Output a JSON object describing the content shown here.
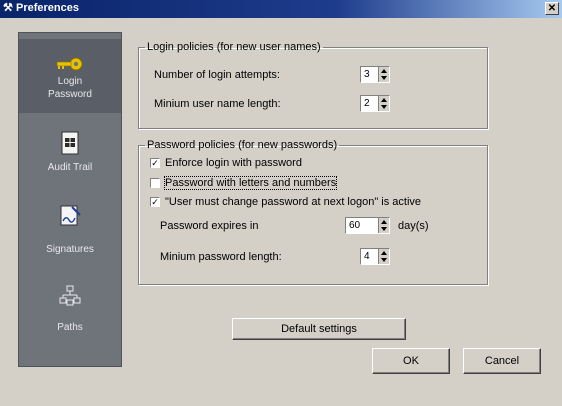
{
  "window": {
    "title": "Preferences",
    "close_symbol": "✕"
  },
  "sidebar": {
    "items": [
      {
        "label_line1": "Login",
        "label_line2": "Password",
        "icon": "key-icon"
      },
      {
        "label": "Audit Trail",
        "icon": "document-icon"
      },
      {
        "label": "Signatures",
        "icon": "signature-icon"
      },
      {
        "label": "Paths",
        "icon": "network-icon"
      }
    ]
  },
  "login_policies": {
    "legend": "Login policies (for new user names)",
    "attempts_label": "Number of login attempts:",
    "attempts_value": "3",
    "min_name_label": "Minium user name length:",
    "min_name_value": "2"
  },
  "password_policies": {
    "legend": "Password policies (for new passwords)",
    "enforce_label": "Enforce login with password",
    "enforce_checked": true,
    "letters_numbers_label": "Password with letters and numbers",
    "letters_numbers_checked": false,
    "must_change_label": "\"User must change password at next logon\" is active",
    "must_change_checked": true,
    "expires_label": "Password expires in",
    "expires_value": "60",
    "expires_unit": "day(s)",
    "min_length_label": "Minium password length:",
    "min_length_value": "4"
  },
  "buttons": {
    "default_settings": "Default settings",
    "ok": "OK",
    "cancel": "Cancel"
  }
}
